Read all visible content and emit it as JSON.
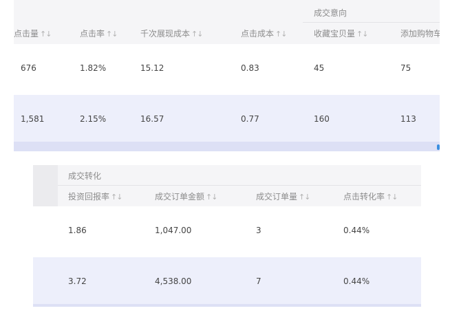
{
  "top_table": {
    "group_label": "成交意向",
    "columns": [
      "点击量",
      "点击率",
      "千次展现成本",
      "点击成本",
      "收藏宝贝量",
      "添加购物车"
    ],
    "sort_glyph": "↑↓",
    "rows": [
      [
        "676",
        "1.82%",
        "15.12",
        "0.83",
        "45",
        "75"
      ],
      [
        "1,581",
        "2.15%",
        "16.57",
        "0.77",
        "160",
        "113"
      ]
    ]
  },
  "bottom_table": {
    "group_label": "成交转化",
    "columns": [
      "投资回报率",
      "成交订单金额",
      "成交订单量",
      "点击转化率"
    ],
    "sort_glyph": "↑↓",
    "rows": [
      [
        "1.86",
        "1,047.00",
        "3",
        "0.44%"
      ],
      [
        "3.72",
        "4,538.00",
        "7",
        "0.44%"
      ]
    ]
  },
  "colors": {
    "header_bg": "#f5f5f7",
    "alt_row_bg": "#edeffb",
    "footer_stripe": "#dde0f5",
    "scroll_indicator": "#3b8fe0"
  }
}
